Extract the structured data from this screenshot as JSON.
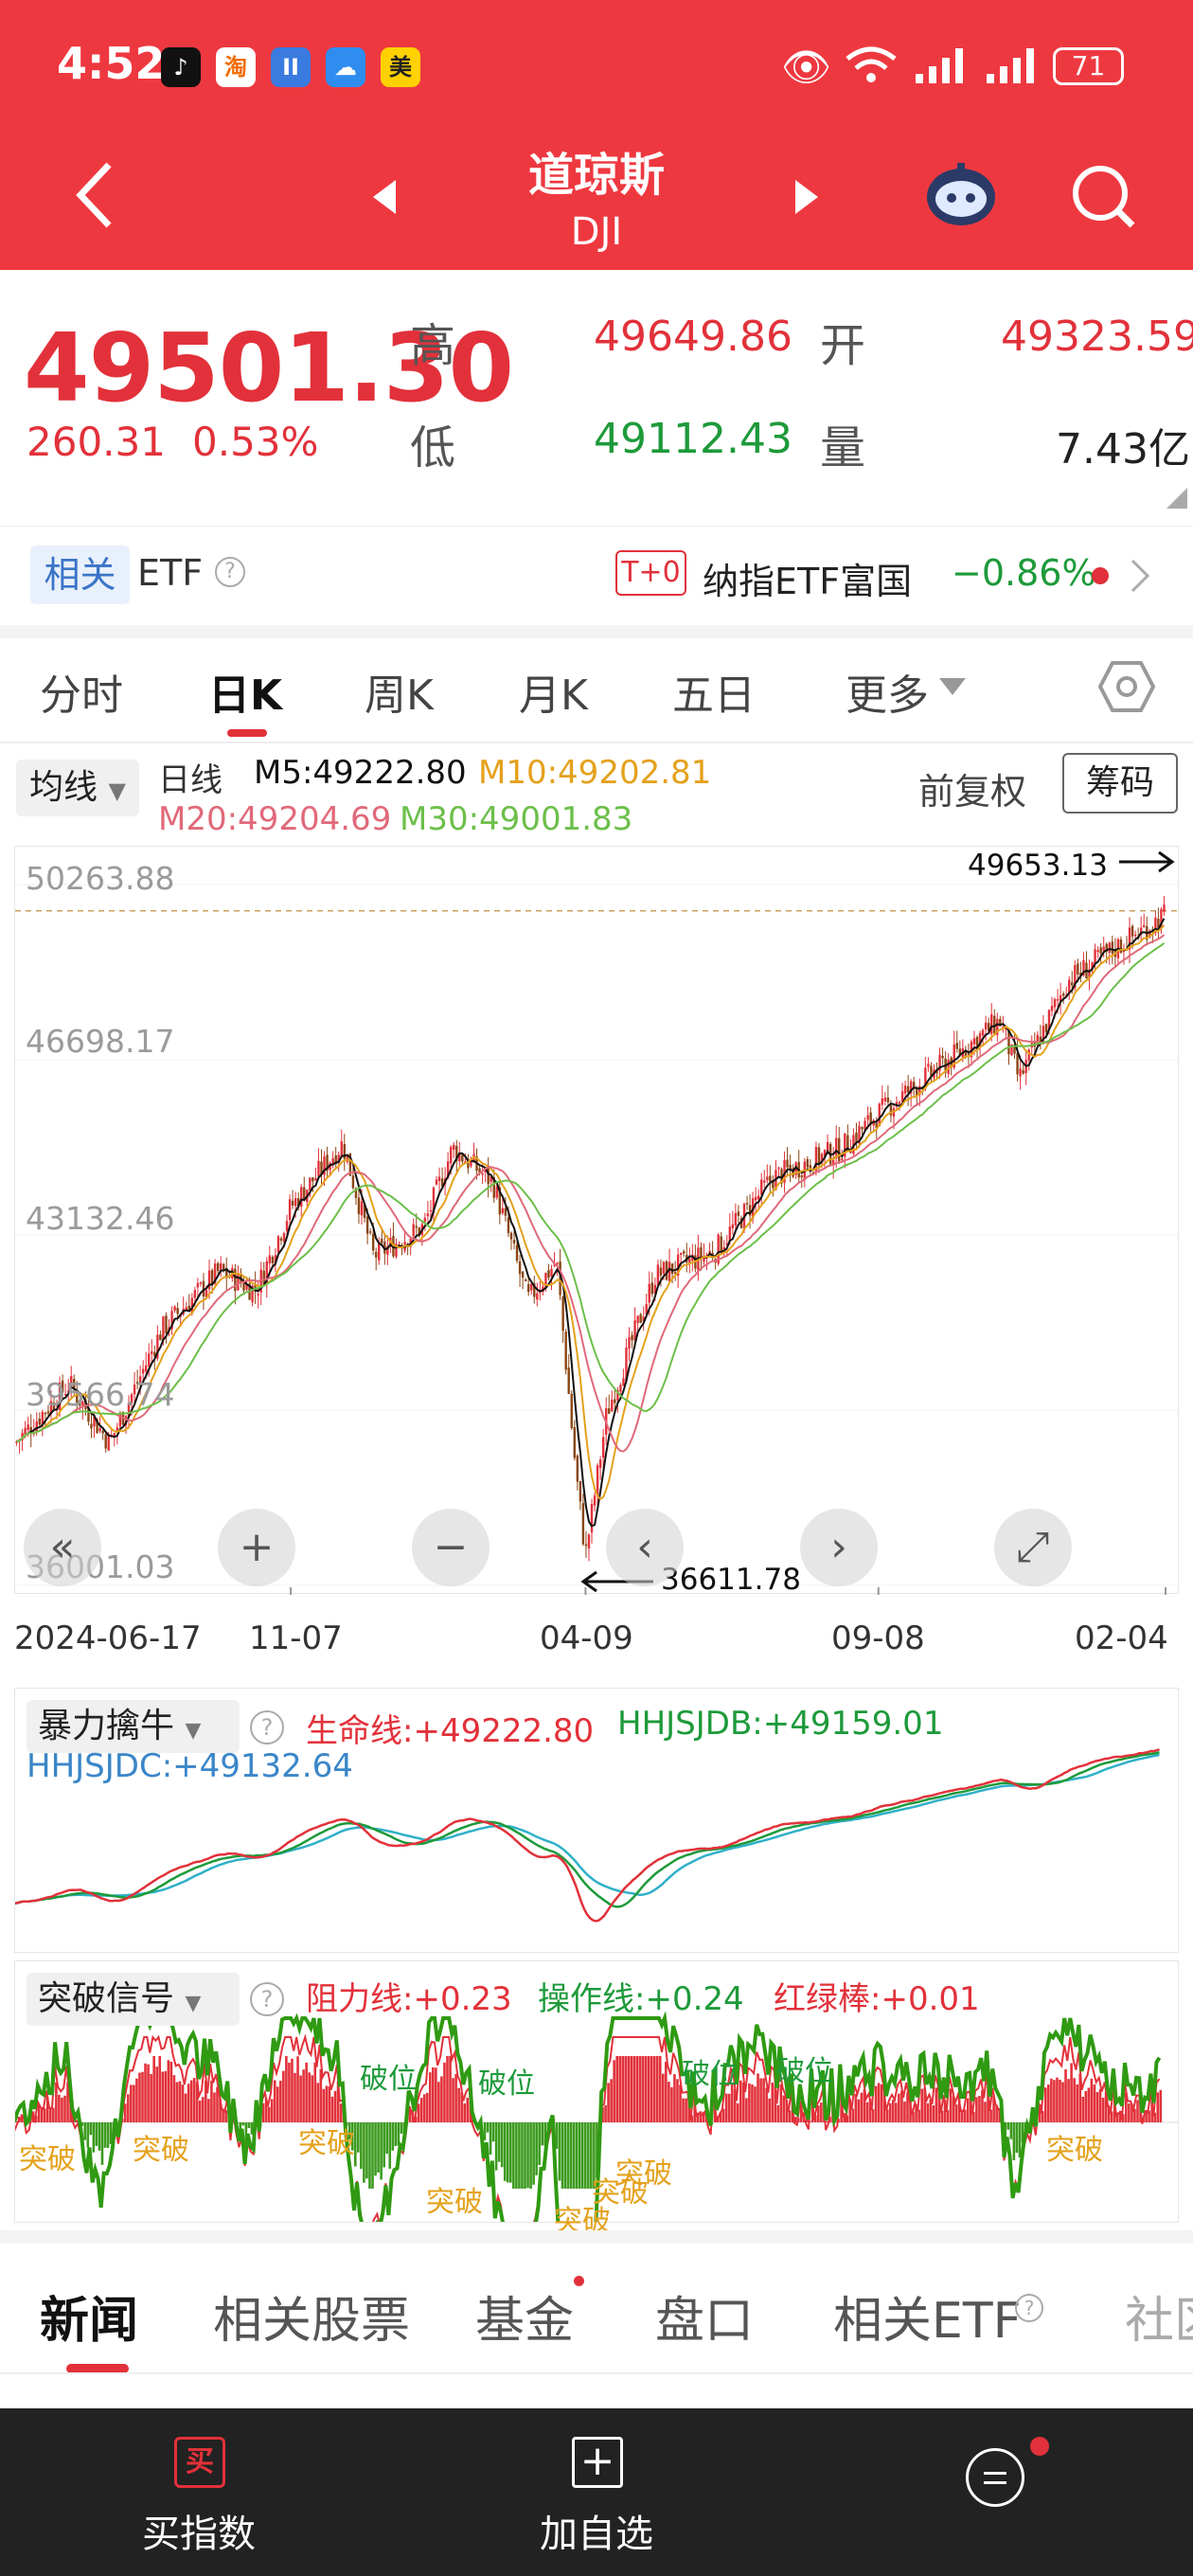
{
  "status": {
    "time": "4:52",
    "battery": "71",
    "app_badges": [
      "♪",
      "淘",
      "II",
      "☁",
      "美"
    ]
  },
  "header": {
    "title": "道琼斯",
    "code": "DJI"
  },
  "quote": {
    "price": "49501.30",
    "change": "260.31",
    "change_pct": "0.53%",
    "high_label": "高",
    "high": "49649.86",
    "open_label": "开",
    "open": "49323.59",
    "low_label": "低",
    "low": "49112.43",
    "volume_label": "量",
    "volume": "7.43亿"
  },
  "etf": {
    "related_label": "相关",
    "etf_label": "ETF",
    "tag": "T+0",
    "name": "纳指ETF富国",
    "change": "−0.86%"
  },
  "tabs": [
    "分时",
    "日K",
    "周K",
    "月K",
    "五日",
    "更多"
  ],
  "indicator_bar": {
    "ma_select": "均线",
    "period": "日线",
    "m5": "M5:49222.80",
    "m10": "M10:49202.81",
    "m20": "M20:49204.69",
    "m30": "M30:49001.83",
    "adjust": "前复权",
    "chips": "筹码"
  },
  "chart_data": {
    "type": "candlestick",
    "y_ticks": [
      "50263.88",
      "46698.17",
      "43132.46",
      "39566.74",
      "36001.03"
    ],
    "x_ticks": [
      "2024-06-17",
      "11-07",
      "04-09",
      "09-08",
      "02-04"
    ],
    "max_annotation": "49653.13",
    "min_annotation": "36611.78",
    "ylim": [
      36001.03,
      50263.88
    ],
    "close_path": [
      [
        "2024-06-17",
        38900
      ],
      [
        "2024-07-15",
        40100
      ],
      [
        "2024-08-05",
        38900
      ],
      [
        "2024-09-01",
        41200
      ],
      [
        "2024-10-01",
        42400
      ],
      [
        "2024-10-20",
        42000
      ],
      [
        "2024-11-07",
        43700
      ],
      [
        "2024-12-04",
        45000
      ],
      [
        "2024-12-20",
        42700
      ],
      [
        "2025-01-15",
        43300
      ],
      [
        "2025-01-30",
        44900
      ],
      [
        "2025-02-20",
        44200
      ],
      [
        "2025-03-10",
        41800
      ],
      [
        "2025-03-25",
        42600
      ],
      [
        "2025-04-04",
        38300
      ],
      [
        "2025-04-09",
        36611.78
      ],
      [
        "2025-04-20",
        39500
      ],
      [
        "2025-05-15",
        42300
      ],
      [
        "2025-06-15",
        42800
      ],
      [
        "2025-07-15",
        44300
      ],
      [
        "2025-08-20",
        44900
      ],
      [
        "2025-09-08",
        45600
      ],
      [
        "2025-10-15",
        46700
      ],
      [
        "2025-11-10",
        47500
      ],
      [
        "2025-11-20",
        46300
      ],
      [
        "2025-12-15",
        48300
      ],
      [
        "2026-01-10",
        49000
      ],
      [
        "2026-02-04",
        49653.13
      ]
    ]
  },
  "controls": [
    "«",
    "+",
    "−",
    "‹",
    "›",
    "⤢"
  ],
  "panel1": {
    "name": "暴力擒牛",
    "life": "生命线:+49222.80",
    "jdb": "HHJSJDB:+49159.01",
    "jdc": "HHJSJDC:+49132.64"
  },
  "panel2": {
    "name": "突破信号",
    "resist": "阻力线:+0.23",
    "oper": "操作线:+0.24",
    "bar": "红绿棒:+0.01",
    "marks": [
      "突破",
      "突破",
      "破位",
      "破位",
      "破位",
      "破位",
      "突破",
      "突破",
      "突破",
      "突破",
      "突破",
      "突破"
    ]
  },
  "bottom_tabs": [
    "新闻",
    "相关股票",
    "基金",
    "盘口",
    "相关ETF",
    "社区"
  ],
  "bottom_nav": {
    "buy": "买指数",
    "buy_icon": "买",
    "add": "加自选"
  },
  "colors": {
    "red": "#e2313a",
    "green": "#1d9a3a",
    "header": "#ee3840",
    "m5": "#111111",
    "m10": "#e4a11b",
    "m20": "#e0697a",
    "m30": "#6cbf4a"
  }
}
